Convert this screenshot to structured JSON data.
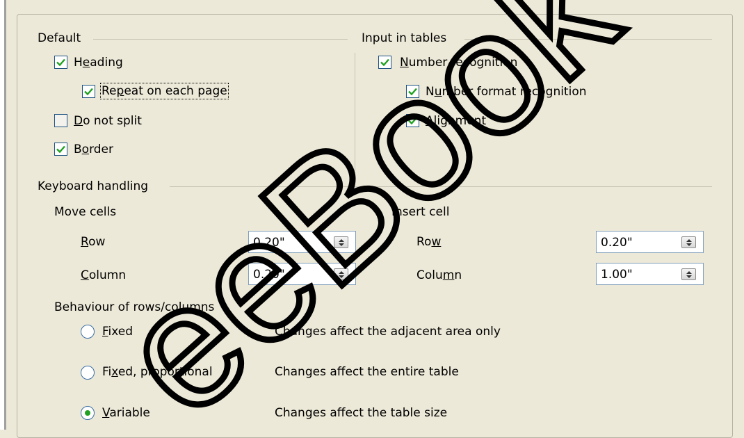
{
  "default": {
    "title": "Default",
    "heading": {
      "pre": "H",
      "acc": "e",
      "post": "ading",
      "checked": true
    },
    "repeat": {
      "pre": "Re",
      "acc": "p",
      "post": "eat on each page",
      "checked": true
    },
    "do_not_split": {
      "pre": "",
      "acc": "D",
      "post": "o not split",
      "checked": false
    },
    "border": {
      "pre": "B",
      "acc": "o",
      "post": "rder",
      "checked": true
    }
  },
  "input_tables": {
    "title": "Input in tables",
    "number_recognition": {
      "pre": "",
      "acc": "N",
      "post": "umber recognition",
      "checked": true
    },
    "number_format": {
      "pre": "N",
      "acc": "u",
      "post": "mber format recognition",
      "checked": true
    },
    "alignment": {
      "pre": "",
      "acc": "A",
      "post": "lignment",
      "checked": true
    }
  },
  "keyboard": {
    "title": "Keyboard handling",
    "move_cells": {
      "label": "Move cells",
      "row": {
        "pre": "",
        "acc": "R",
        "post": "ow",
        "value": "0.20\""
      },
      "column": {
        "pre": "",
        "acc": "C",
        "post": "olumn",
        "value": "0.20\""
      }
    },
    "insert_cell": {
      "label": "Insert cell",
      "row": {
        "pre": "Ro",
        "acc": "w",
        "post": "",
        "value": "0.20\""
      },
      "column": {
        "pre": "Colu",
        "acc": "m",
        "post": "n",
        "value": "1.00\""
      }
    },
    "behaviour": {
      "label": "Behaviour of rows/columns",
      "options": [
        {
          "pre": "",
          "acc": "F",
          "post": "ixed",
          "desc": "Changes affect the adjacent area only",
          "selected": false
        },
        {
          "pre": "Fi",
          "acc": "x",
          "post": "ed, proportional",
          "desc": "Changes affect the entire table",
          "selected": false
        },
        {
          "pre": "",
          "acc": "V",
          "post": "ariable",
          "desc": "Changes affect the table size",
          "selected": true
        }
      ]
    }
  },
  "watermark": {
    "text": "eeBook Ex"
  },
  "colors": {
    "check": "#21a121",
    "radio": "#21a121"
  }
}
